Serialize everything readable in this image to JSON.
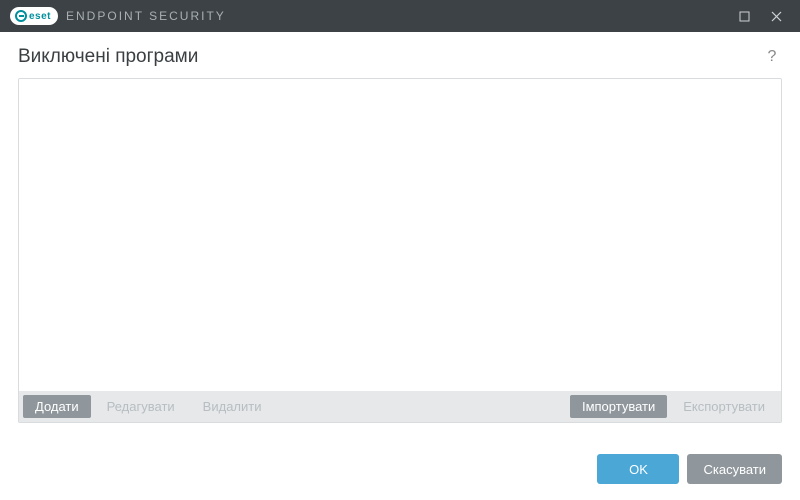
{
  "titlebar": {
    "brand": "eset",
    "product": "ENDPOINT SECURITY"
  },
  "header": {
    "title": "Виключені програми"
  },
  "list": {
    "items": []
  },
  "toolbar": {
    "add": "Додати",
    "edit": "Редагувати",
    "delete": "Видалити",
    "import": "Імпортувати",
    "export": "Експортувати"
  },
  "footer": {
    "ok": "OK",
    "cancel": "Скасувати"
  }
}
